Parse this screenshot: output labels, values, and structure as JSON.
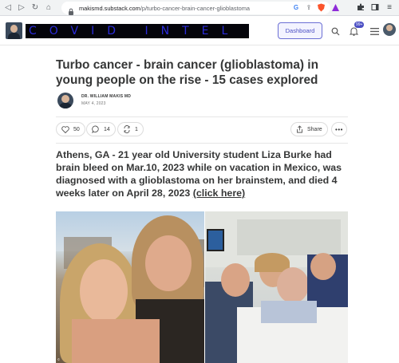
{
  "browser": {
    "url_host": "makismd.substack.com",
    "url_path": "/p/turbo-cancer-brain-cancer-glioblastoma"
  },
  "header": {
    "publication_banner": "COVID INTEL",
    "dashboard_label": "Dashboard",
    "notification_count": "99+"
  },
  "post": {
    "title": "Turbo cancer - brain cancer (glioblastoma) in young people on the rise - 15 cases explored",
    "author": "DR. WILLIAM MAKIS MD",
    "date": "MAY 4, 2023",
    "likes": "50",
    "comments": "14",
    "restacks": "1",
    "share_label": "Share",
    "subtitle_text": "Athens, GA - 21 year old University student Liza Burke had brain bleed on Mar.10, 2023 while on vacation in Mexico, was diagnosed with a glioblastoma on her brainstem, and died 4 weeks later on April 28, 2023 ",
    "subtitle_link": "(click here)"
  },
  "colors": {
    "accent": "#4b4fc4",
    "text": "#363737"
  }
}
